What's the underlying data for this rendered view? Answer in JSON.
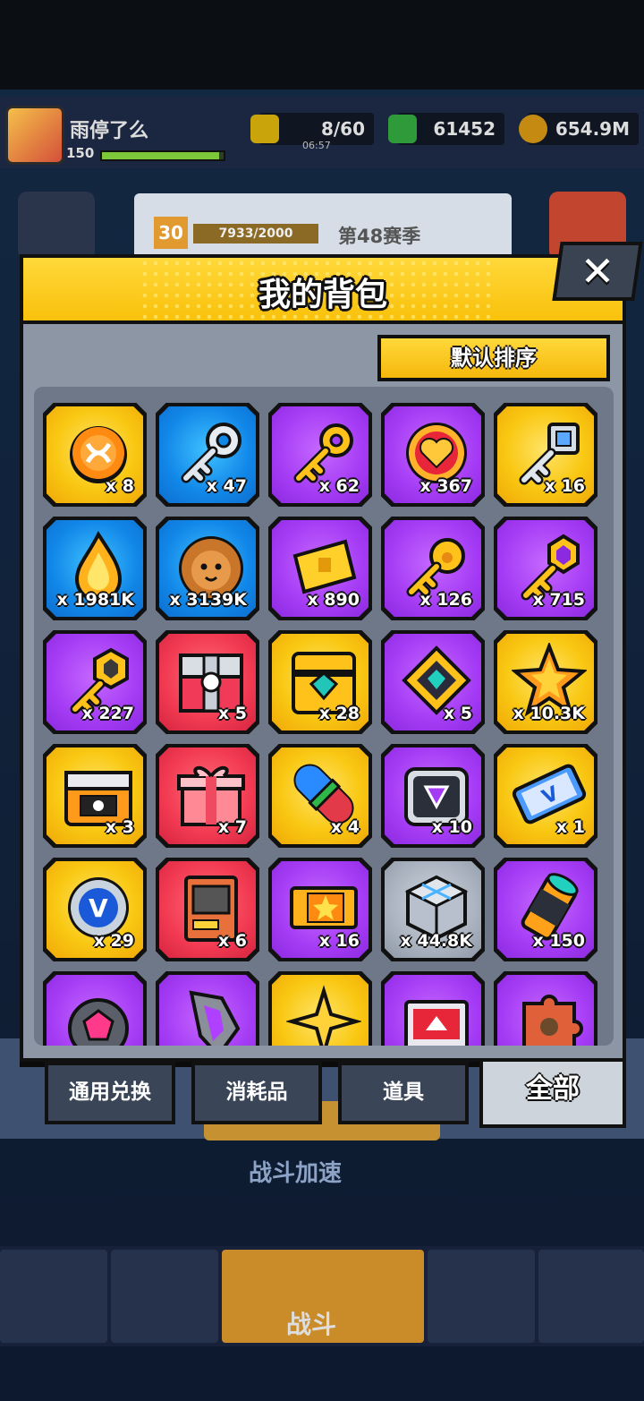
{
  "player": {
    "name": "雨停了么",
    "level": "150"
  },
  "resources": {
    "energy": "8/60",
    "energy_timer": "06:57",
    "gems": "61452",
    "coins": "654.9M"
  },
  "season": {
    "level": "30",
    "progress": "7933/2000",
    "label": "第48赛季"
  },
  "background": {
    "speed_label": "战斗加速",
    "nav_fight": "战斗"
  },
  "backpack": {
    "title": "我的背包",
    "sort_label": "默认排序",
    "close_label": "✕",
    "items": [
      {
        "rarity": "gold",
        "icon": "orange-token-icon",
        "count": "x 8"
      },
      {
        "rarity": "blue",
        "icon": "silver-key-icon",
        "count": "x 47"
      },
      {
        "rarity": "purple",
        "icon": "gold-key-icon",
        "count": "x 62"
      },
      {
        "rarity": "purple",
        "icon": "heart-coin-icon",
        "count": "x 367"
      },
      {
        "rarity": "gold",
        "icon": "crystal-key-icon",
        "count": "x 16"
      },
      {
        "rarity": "blue",
        "icon": "flame-drop-icon",
        "count": "x 1981K"
      },
      {
        "rarity": "blue",
        "icon": "lion-cookie-icon",
        "count": "x 3139K"
      },
      {
        "rarity": "purple",
        "icon": "gold-ticket-icon",
        "count": "x 890"
      },
      {
        "rarity": "purple",
        "icon": "paw-key-icon",
        "count": "x 126"
      },
      {
        "rarity": "purple",
        "icon": "gem-key-icon",
        "count": "x 715"
      },
      {
        "rarity": "purple",
        "icon": "hex-key-icon",
        "count": "x 227"
      },
      {
        "rarity": "red",
        "icon": "red-chest-icon",
        "count": "x 5"
      },
      {
        "rarity": "gold",
        "icon": "gold-chest-icon",
        "count": "x 28"
      },
      {
        "rarity": "purple",
        "icon": "diamond-card-icon",
        "count": "x 5"
      },
      {
        "rarity": "gold",
        "icon": "star-crystal-icon",
        "count": "x 10.3K"
      },
      {
        "rarity": "gold",
        "icon": "treasure-chest-icon",
        "count": "x 3"
      },
      {
        "rarity": "red",
        "icon": "gift-box-icon",
        "count": "x 7"
      },
      {
        "rarity": "gold",
        "icon": "capsule-icon",
        "count": "x 4"
      },
      {
        "rarity": "purple",
        "icon": "silver-crate-icon",
        "count": "x 10"
      },
      {
        "rarity": "gold",
        "icon": "v-ticket-icon",
        "count": "x 1"
      },
      {
        "rarity": "gold",
        "icon": "v-coin-icon",
        "count": "x 29"
      },
      {
        "rarity": "red",
        "icon": "machine-icon",
        "count": "x 6"
      },
      {
        "rarity": "purple",
        "icon": "star-ticket-icon",
        "count": "x 16"
      },
      {
        "rarity": "gray",
        "icon": "metal-cube-icon",
        "count": "x 44.8K"
      },
      {
        "rarity": "purple",
        "icon": "cylinder-icon",
        "count": "x 150"
      },
      {
        "rarity": "purple",
        "icon": "pink-gem-icon",
        "count": ""
      },
      {
        "rarity": "purple",
        "icon": "crystal-shard-icon",
        "count": ""
      },
      {
        "rarity": "gold",
        "icon": "gold-star-icon",
        "count": ""
      },
      {
        "rarity": "purple",
        "icon": "red-box-icon",
        "count": ""
      },
      {
        "rarity": "purple",
        "icon": "puzzle-piece-icon",
        "count": ""
      }
    ],
    "tabs": [
      {
        "label": "通用兑换",
        "active": false
      },
      {
        "label": "消耗品",
        "active": false
      },
      {
        "label": "道具",
        "active": false
      },
      {
        "label": "全部",
        "active": true
      }
    ]
  }
}
